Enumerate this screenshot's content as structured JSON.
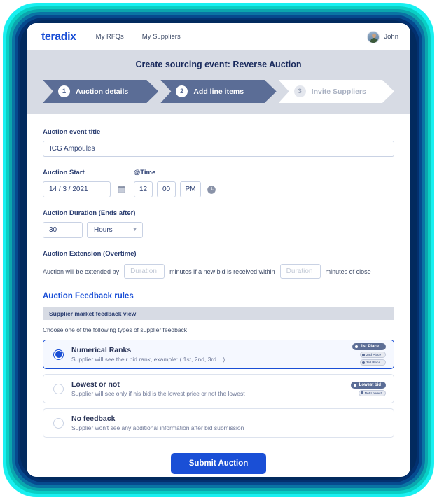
{
  "brand": {
    "logo_text": "teradix",
    "accent": "#1a4fd6",
    "step_active": "#5b6d96",
    "band": "#d7dbe4"
  },
  "topnav": {
    "links": [
      {
        "label": "My RFQs"
      },
      {
        "label": "My Suppliers"
      }
    ],
    "user": {
      "name": "John",
      "avatar_icon": "user-avatar"
    }
  },
  "header": {
    "title": "Create sourcing event: Reverse Auction",
    "steps": [
      {
        "num": "1",
        "label": "Auction details",
        "state": "active"
      },
      {
        "num": "2",
        "label": "Add line items",
        "state": "active"
      },
      {
        "num": "3",
        "label": "Invite Suppliers",
        "state": "inactive"
      }
    ]
  },
  "form": {
    "title_label": "Auction event title",
    "title_value": "ICG Ampoules",
    "title_placeholder": "",
    "start_label": "Auction Start",
    "start_value": "14 / 3 / 2021",
    "time_label": "@Time",
    "time_hour": "12",
    "time_minute": "00",
    "time_ampm": "PM",
    "calendar_icon": "calendar-icon",
    "clock_icon": "clock-icon",
    "duration_label": "Auction Duration (Ends after)",
    "duration_value": "30",
    "duration_unit": "Hours",
    "extension_label": "Auction Extension (Overtime)",
    "ext_text_1": "Auction will be extended by",
    "ext_placeholder_1": "Duration",
    "ext_text_2": "minutes if a new bid is received within",
    "ext_placeholder_2": "Duration",
    "ext_text_3": "minutes of close"
  },
  "feedback": {
    "section_title": "Auction Feedback rules",
    "bar_label": "Supplier market feedback view",
    "choose_label": "Choose one of the following types of supplier feedback",
    "options": [
      {
        "title": "Numerical Ranks",
        "desc": "Supplier will see their bid rank, example: ( 1st, 2nd, 3rd... )",
        "selected": true,
        "badges": [
          {
            "label": "1st Place",
            "kind": "large"
          },
          {
            "label": "2nd Place",
            "kind": "small"
          },
          {
            "label": "3rd Place",
            "kind": "small"
          }
        ]
      },
      {
        "title": "Lowest or not",
        "desc": "Supplier will see only if his bid is the lowest price or not the lowest",
        "selected": false,
        "badges": [
          {
            "label": "Lowest bid",
            "kind": "large"
          },
          {
            "label": "Not Lowest",
            "kind": "small"
          }
        ]
      },
      {
        "title": "No feedback",
        "desc": "Supplier won't see any additional information after bid submission",
        "selected": false,
        "badges": []
      }
    ]
  },
  "submit": {
    "label": "Submit Auction"
  }
}
